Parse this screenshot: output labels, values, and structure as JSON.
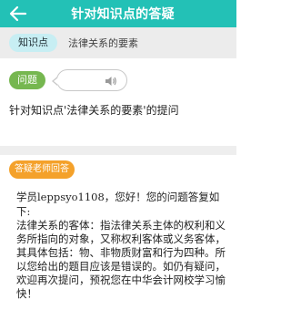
{
  "header": {
    "title": "针对知识点的答疑"
  },
  "topic": {
    "tag": "知识点",
    "name": "法律关系的要素"
  },
  "question": {
    "badge": "问题",
    "text": "针对知识点'法律关系的要素'的提问"
  },
  "answer": {
    "badge": "答疑老师回答",
    "greeting": "学员leppsyo1108，您好！您的问题答复如下:",
    "body": "法律关系的客体：指法律关系主体的权利和义务所指向的对象，又称权利客体或义务客体，其具体包括：物、非物质财富和行为四种。所以您给出的题目应该是错误的。如仍有疑问，欢迎再次提问，预祝您在中华会计网校学习愉快！"
  },
  "colors": {
    "header_bg": "#23c1b6",
    "topic_bar_bg": "#ececec",
    "topic_tag_bg": "#c7eef3",
    "question_badge": "#76b750",
    "answer_badge": "#f4a12a"
  },
  "icons": {
    "back": "arrow-left-icon",
    "voice": "speaker-icon"
  }
}
